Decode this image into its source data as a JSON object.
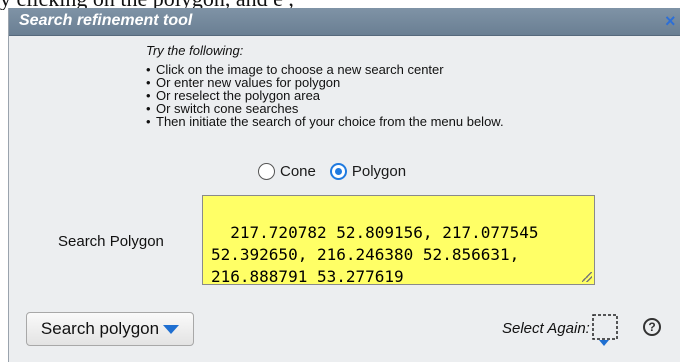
{
  "backdrop_text": "y clicking on the polygon, and e      ,",
  "dialog": {
    "title": "Search refinement tool",
    "close_glyph": "×",
    "close_icon_color": "#2d6fd6"
  },
  "instructions": {
    "heading": "Try the following:",
    "items": [
      "Click on the image to choose a new search center",
      "Or enter new values for polygon",
      "Or reselect the polygon area",
      "Or switch cone searches",
      "Then initiate the search of your choice from the menu below."
    ]
  },
  "search_type": {
    "options": [
      {
        "label": "Cone",
        "selected": false
      },
      {
        "label": "Polygon",
        "selected": true
      }
    ]
  },
  "polygon": {
    "label": "Search Polygon",
    "value": "217.720782 52.809156, 217.077545 52.392650, 216.246380 52.856631, 216.888791 53.277619",
    "field_color": "#ffff66"
  },
  "search_button": {
    "label": "Search polygon",
    "icon": "chevron-down-icon",
    "caret_color": "#1f6fd1"
  },
  "select_again": {
    "label": "Select Again:",
    "icon": "dashed-selection-icon"
  },
  "help": {
    "glyph": "?",
    "icon": "help-icon"
  },
  "colors": {
    "titlebar": "#6a7f93",
    "dialog_background": "#eceef0",
    "accent": "#1f7ae0"
  }
}
